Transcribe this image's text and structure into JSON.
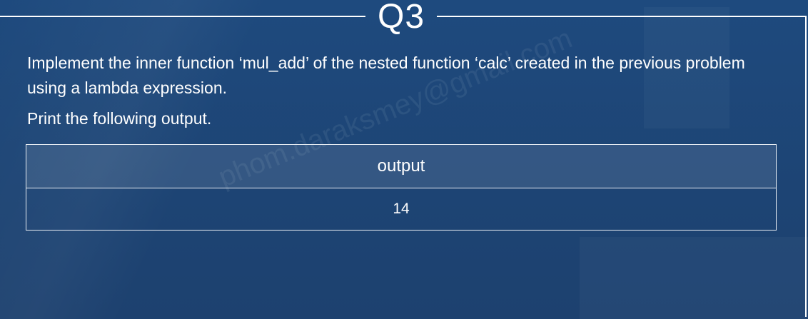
{
  "header": {
    "title": "Q3"
  },
  "question": {
    "text": "Implement the inner function ‘mul_add’ of the nested function ‘calc’ created in the previous problem using a lambda expression.",
    "instruction": "Print the following output."
  },
  "output_table": {
    "header": "output",
    "value": "14"
  },
  "watermark": "phom.daraksmey@gmail.com",
  "colors": {
    "background": "#1e4a7e",
    "table_header": "#3a5f8c",
    "text": "#ffffff"
  }
}
